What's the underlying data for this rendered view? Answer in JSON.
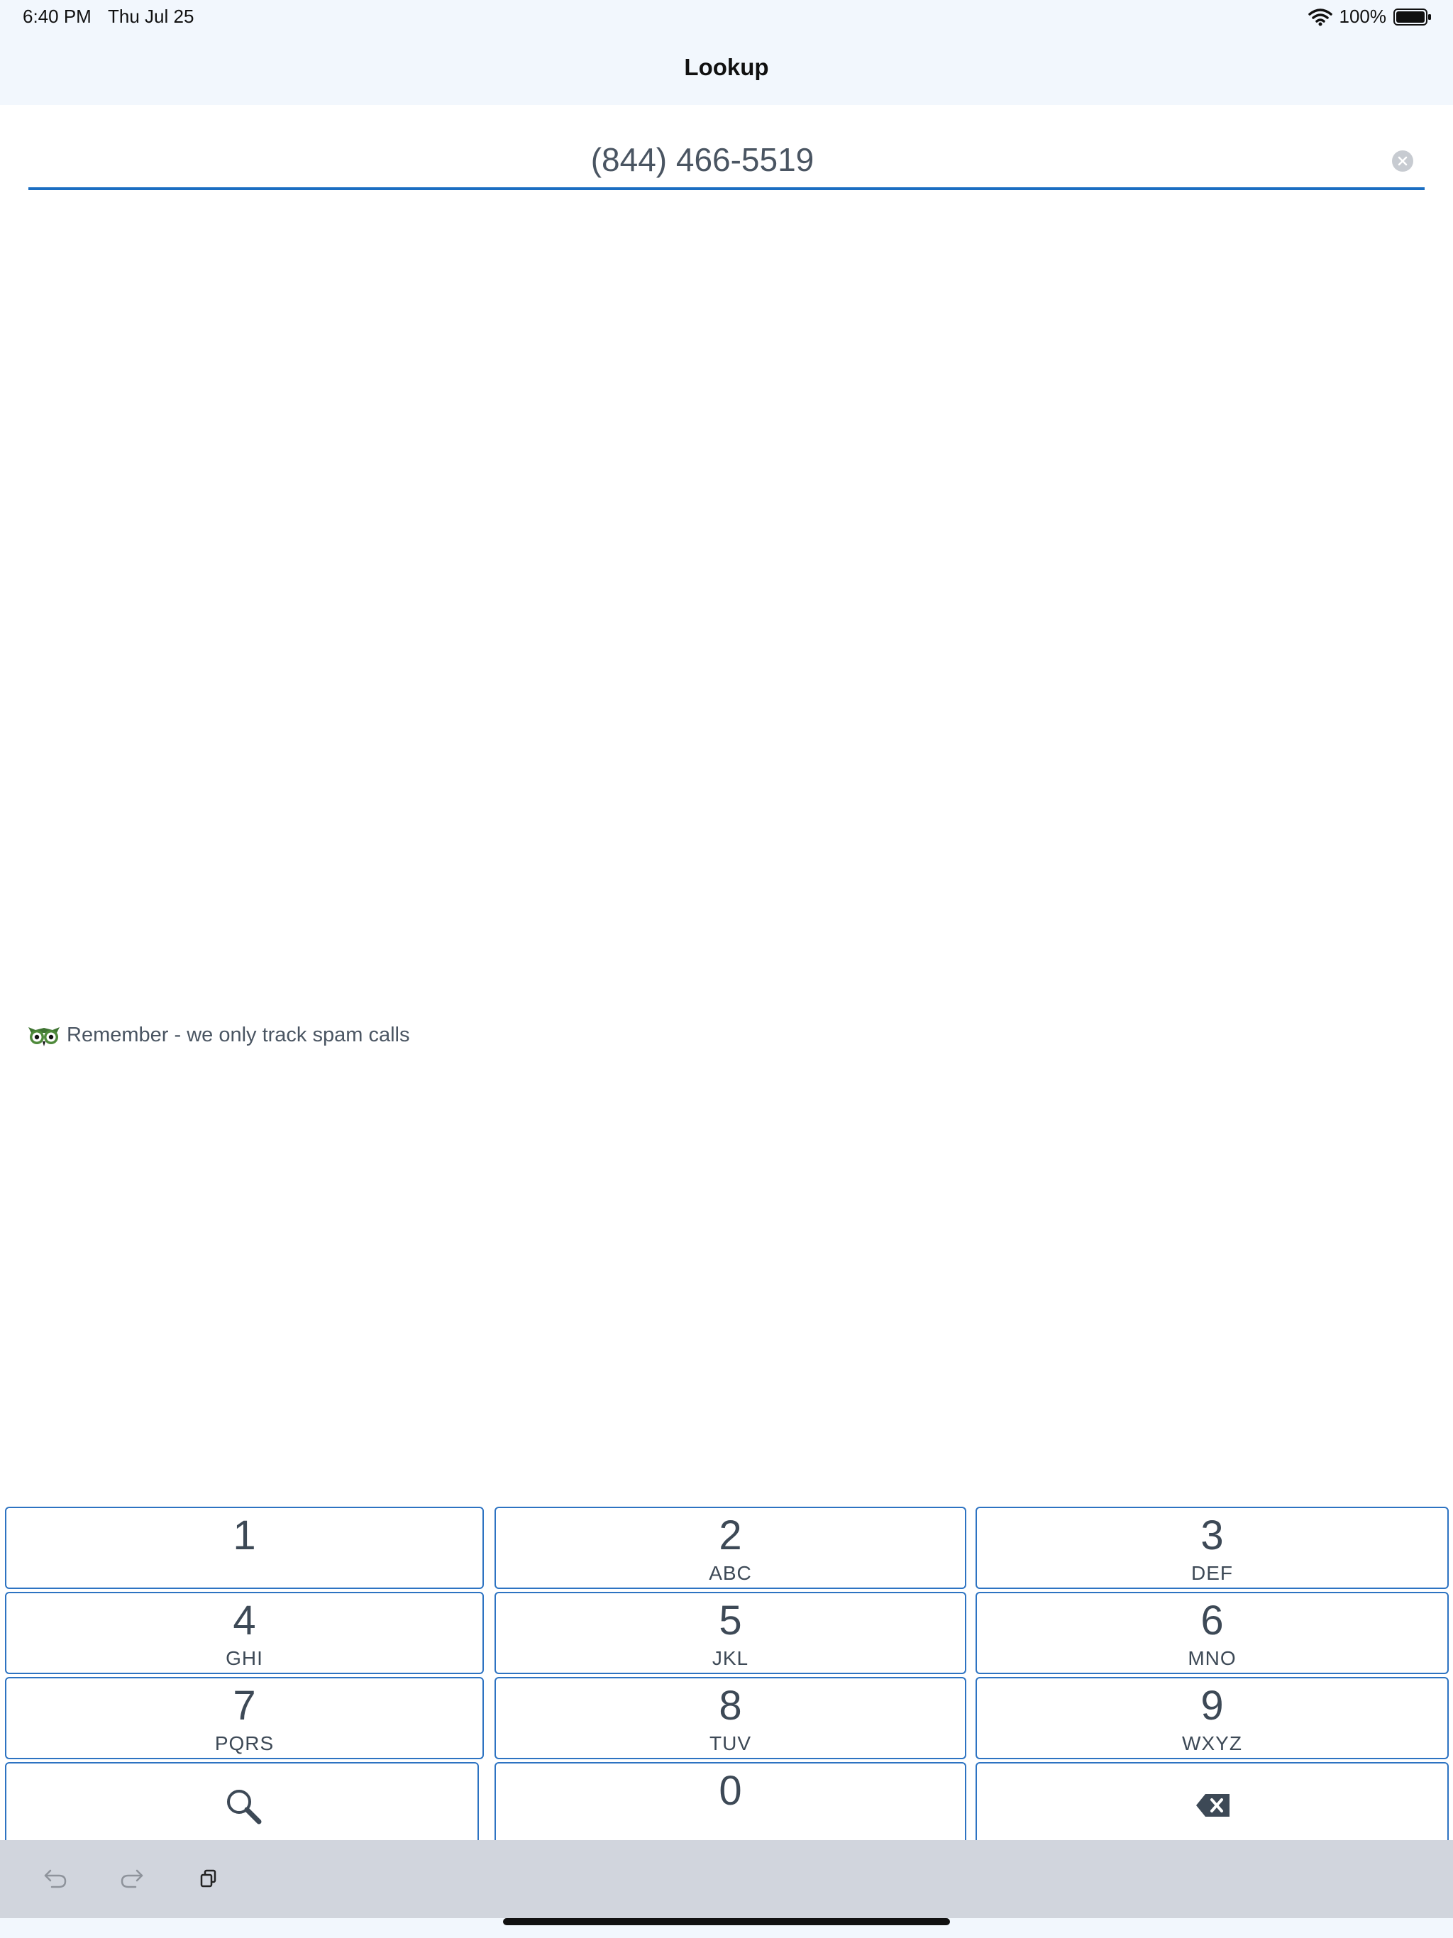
{
  "status_bar": {
    "time": "6:40 PM",
    "date": "Thu Jul 25",
    "battery": "100%"
  },
  "nav": {
    "title": "Lookup"
  },
  "lookup": {
    "phone_value": "(844) 466-5519"
  },
  "reminder": {
    "text": "Remember - we only track spam calls"
  },
  "keypad": {
    "keys": [
      {
        "digit": "1",
        "letters": ""
      },
      {
        "digit": "2",
        "letters": "ABC"
      },
      {
        "digit": "3",
        "letters": "DEF"
      },
      {
        "digit": "4",
        "letters": "GHI"
      },
      {
        "digit": "5",
        "letters": "JKL"
      },
      {
        "digit": "6",
        "letters": "MNO"
      },
      {
        "digit": "7",
        "letters": "PQRS"
      },
      {
        "digit": "8",
        "letters": "TUV"
      },
      {
        "digit": "9",
        "letters": "WXYZ"
      },
      {
        "digit": "0",
        "letters": ""
      }
    ],
    "search_icon": "search-icon",
    "delete_icon": "backspace-icon"
  },
  "toolbar": {
    "icons": [
      "undo-icon",
      "redo-icon",
      "paste-icon"
    ]
  },
  "colors": {
    "accent": "#1b6ec2",
    "key_border": "#2d73c2",
    "nav_bg": "#f2f7fd",
    "toolbar_bg": "#d1d5dd",
    "owl_green": "#4f8a3b"
  }
}
